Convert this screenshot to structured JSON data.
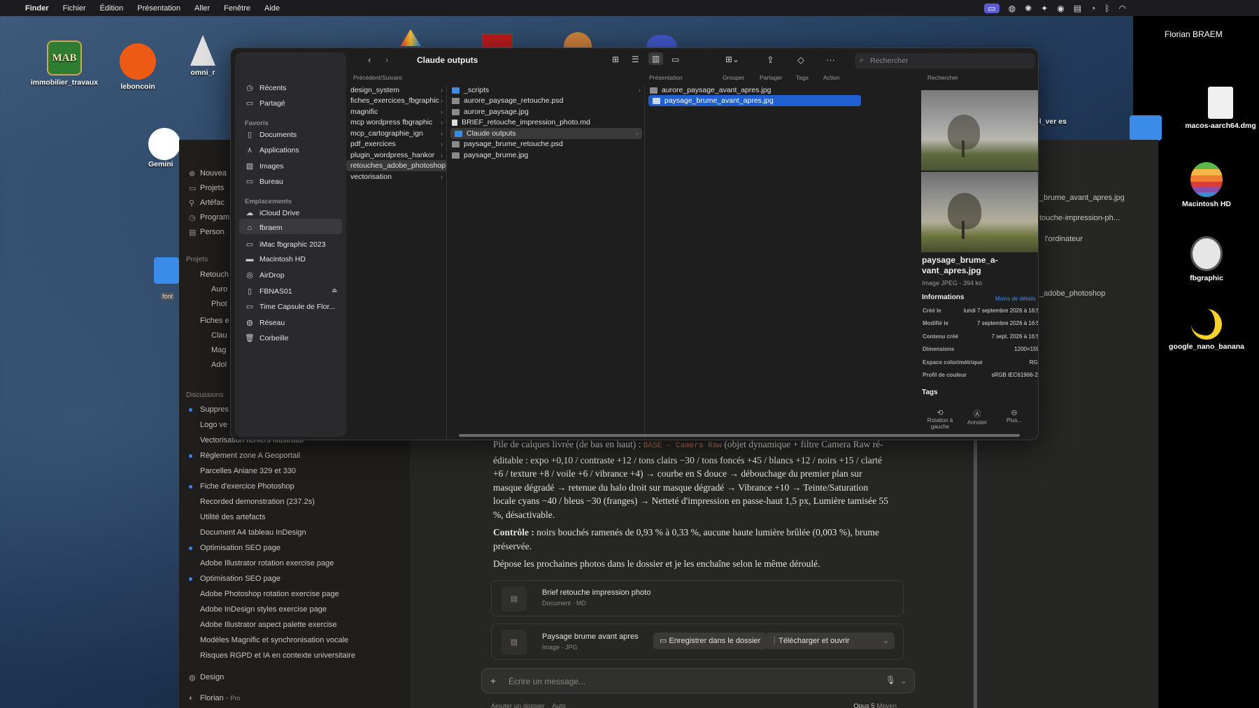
{
  "menubar": {
    "app": "Finder",
    "menus": [
      "Fichier",
      "Édition",
      "Présentation",
      "Aller",
      "Fenêtre",
      "Aide"
    ],
    "user": "Florian BRAEM"
  },
  "desktop": {
    "icons": [
      {
        "label": "immobilier_travaux",
        "logo": "MAB"
      },
      {
        "label": "leboncoin"
      },
      {
        "label": "omni_r"
      },
      {
        "label": "Gemini"
      },
      {
        "label": "el_ver es"
      },
      {
        "label": "macos-aarch64.dmg"
      },
      {
        "label": "Macintosh HD"
      },
      {
        "label": "fbgraphic"
      },
      {
        "label": "google_nano_banana"
      }
    ]
  },
  "finder": {
    "title": "Claude outputs",
    "nav_label": "Précédent/Suivant",
    "toolbar_labels": {
      "presentation": "Présentation",
      "grouper": "Grouper",
      "partager": "Partager",
      "tags": "Tags",
      "action": "Action",
      "rechercher": "Rechercher"
    },
    "search_placeholder": "Rechercher",
    "sidebar": {
      "top": [
        {
          "label": "Récents",
          "icon": "clock-icon"
        },
        {
          "label": "Partagé",
          "icon": "shared-folder-icon"
        }
      ],
      "favoris_header": "Favoris",
      "favoris": [
        {
          "label": "Documents",
          "icon": "document-icon"
        },
        {
          "label": "Applications",
          "icon": "applications-icon"
        },
        {
          "label": "Images",
          "icon": "photo-icon"
        },
        {
          "label": "Bureau",
          "icon": "desktop-icon"
        }
      ],
      "emplacements_header": "Emplacements",
      "emplacements": [
        {
          "label": "iCloud Drive",
          "icon": "cloud-icon"
        },
        {
          "label": "fbraem",
          "icon": "home-icon"
        },
        {
          "label": "iMac fbgraphic 2023",
          "icon": "imac-icon"
        },
        {
          "label": "Macintosh HD",
          "icon": "disk-icon"
        },
        {
          "label": "AirDrop",
          "icon": "airdrop-icon"
        },
        {
          "label": "FBNAS01",
          "icon": "server-icon"
        },
        {
          "label": "Time Capsule de Flor...",
          "icon": "time-capsule-icon"
        },
        {
          "label": "Réseau",
          "icon": "network-icon"
        },
        {
          "label": "Corbeille",
          "icon": "trash-icon"
        }
      ]
    },
    "col1": [
      "design_system",
      "fiches_exercices_fbgraphic",
      "magnific",
      "mcp wordpress fbgraphic",
      "mcp_cartographie_ign",
      "pdf_exercices",
      "plugin_wordpress_hankor",
      "retouches_adobe_photoshop",
      "vectorisation"
    ],
    "col2": [
      {
        "name": "_scripts",
        "kind": "folder"
      },
      {
        "name": "aurore_paysage_retouche.psd",
        "kind": "image"
      },
      {
        "name": "aurore_paysage.jpg",
        "kind": "image"
      },
      {
        "name": "BRIEF_retouche_impression_photo.md",
        "kind": "doc"
      },
      {
        "name": "Claude outputs",
        "kind": "folder"
      },
      {
        "name": "paysage_brume_retouche.psd",
        "kind": "image"
      },
      {
        "name": "paysage_brume.jpg",
        "kind": "image"
      }
    ],
    "col3": [
      "aurore_paysage_avant_apres.jpg",
      "paysage_brume_avant_apres.jpg"
    ],
    "preview": {
      "filename": "paysage_brume_a-vant_apres.jpg",
      "type": "Image JPEG - 394 ko",
      "info_header": "Informations",
      "less": "Moins de détails",
      "rows": [
        {
          "k": "Créé le",
          "v": "lundi 7 septembre 2026 à 16:5"
        },
        {
          "k": "Modifié le",
          "v": "7 septembre 2026 à 16:5"
        },
        {
          "k": "Contenu créé",
          "v": "7 sept. 2026 à 16:5"
        },
        {
          "k": "Dimensions",
          "v": "1200×159"
        },
        {
          "k": "Espace colorimétrique",
          "v": "RGI"
        },
        {
          "k": "Profil de couleur",
          "v": "sRGB IEC61966-2."
        }
      ],
      "tags_header": "Tags",
      "actions": [
        "Rotation à gauche",
        "Annoter",
        "Plus..."
      ]
    }
  },
  "claude": {
    "sidebar": {
      "top": [
        "Nouvea",
        "Projets",
        "Artéfac",
        "Program",
        "Person"
      ],
      "projets_header": "Projets",
      "projets": [
        "Retouch",
        "Auro",
        "Phot"
      ],
      "fiches": [
        "Fiches e",
        "Clau",
        "Mag",
        "Adol"
      ],
      "discussions_header": "Discussions",
      "discussions": [
        "Suppres",
        "Logo ve",
        "Vectorisation fichiers Illustrator",
        "Règlement zone A Geoportail",
        "Parcelles Aniane 329 et 330",
        "Fiche d'exercice Photoshop",
        "Recorded demonstration (237.2s)",
        "Utilité des artefacts",
        "Document A4 tableau InDesign",
        "Optimisation SEO page",
        "Adobe Illustrator rotation exercise page",
        "Optimisation SEO page",
        "Adobe Photoshop rotation exercise page",
        "Adobe InDesign styles exercise page",
        "Adobe Illustrator aspect palette exercise",
        "Modèles Magnific et synchronisation vocale",
        "Risques RGPD et IA en contexte universitaire"
      ],
      "design": "Design",
      "user": "Florian",
      "plan": "Pro",
      "folder_label": "font"
    },
    "right_panel": {
      "file1": "_brume_avant_apres.jpg",
      "file2": "touche-impression-ph...",
      "ordinateur": "l'ordinateur",
      "folder": "_adobe_photoshop"
    },
    "main": {
      "p1_a": "Pile de calques livrée (de bas en haut) : ",
      "p1_code": "BASE – Camera Raw",
      "p1_b": " (objet dynamique + filtre Camera Raw ré-éditable : expo +0,10 / contraste +12 / tons clairs −30 / tons foncés +45 / blancs +12 / noirs +15 / clarté +6 / texture +8 / voile +6 / vibrance +4) → courbe en S douce → débouchage du premier plan sur masque dégradé → retenue du halo droit sur masque dégradé → Vibrance +10 → Teinte/Saturation locale cyans −40 / bleus −30 (franges) → Netteté d'impression en passe-haut 1,5 px, Lumière tamisée 55 %, désactivable.",
      "p2_bold": "Contrôle :",
      "p2": " noirs bouchés ramenés de 0,93 % à 0,33 %, aucune haute lumière brûlée (0,003 %), brume préservée.",
      "p3": "Dépose les prochaines photos dans le dossier et je les enchaîne selon le même déroulé.",
      "card1_title": "Brief retouche impression photo",
      "card1_sub": "Document · MD",
      "card2_title": "Paysage brume avant apres",
      "card2_sub": "Image · JPG",
      "btn_save": "Enregistrer dans le dossier",
      "btn_dl": "Télécharger et ouvrir",
      "composer_placeholder": "Écrire un message...",
      "footer_left": "Ajouter un dossier",
      "footer_auto": "Auto",
      "model": "Opus 5",
      "effort": "Moyen"
    }
  }
}
